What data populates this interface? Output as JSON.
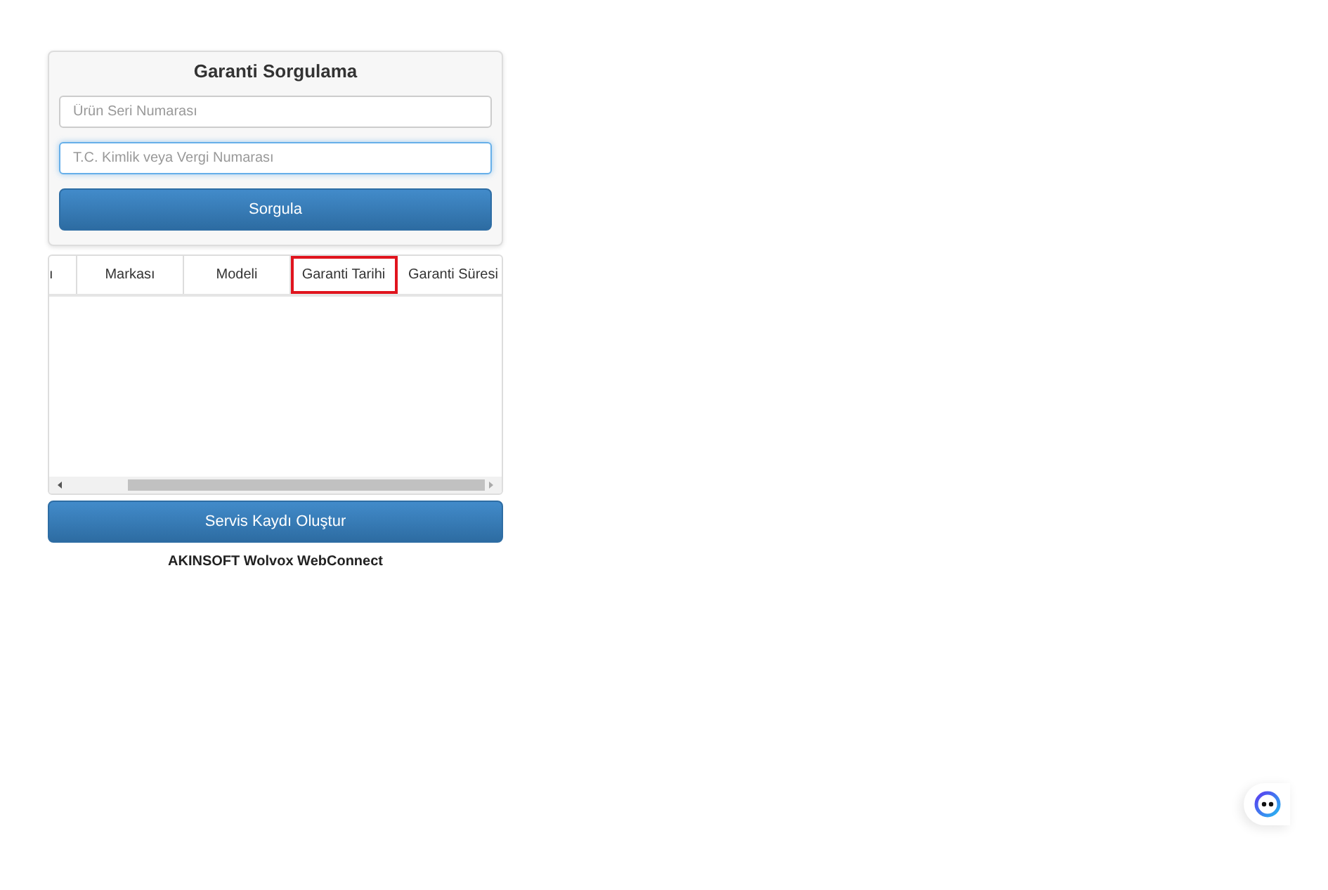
{
  "query_panel": {
    "title": "Garanti Sorgulama",
    "fields": [
      {
        "placeholder": "Ürün Seri Numarası",
        "focused": false
      },
      {
        "placeholder": "T.C. Kimlik veya Vergi Numarası",
        "focused": true
      }
    ],
    "submit_button": "Sorgula"
  },
  "table": {
    "columns": [
      {
        "label": "ı",
        "highlighted": false
      },
      {
        "label": "Markası",
        "highlighted": false
      },
      {
        "label": "Modeli",
        "highlighted": false
      },
      {
        "label": "Garanti Tarihi",
        "highlighted": true
      },
      {
        "label": "Garanti Süresi",
        "highlighted": false
      }
    ]
  },
  "service_button": "Servis Kaydı Oluştur",
  "footer": "AKINSOFT Wolvox WebConnect"
}
